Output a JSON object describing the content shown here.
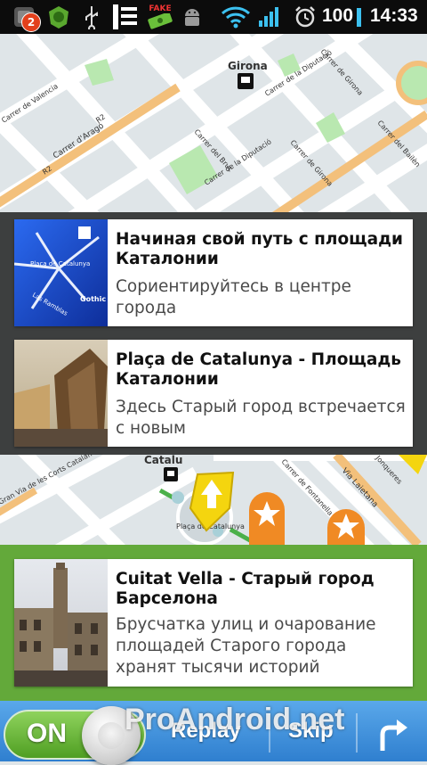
{
  "status_bar": {
    "notification_count": "2",
    "fake_label": "FAKE",
    "battery": "100",
    "time": "14:33",
    "battery_color": "#3cc1f0"
  },
  "map_top": {
    "labels": [
      "Girona",
      "Carrer de Valencia",
      "Carrer d'Aragó",
      "R2",
      "R2",
      "Carrer de la Diputació",
      "Carrer de Girona",
      "Carrer del Bruc",
      "Carrer de la Diputació",
      "Carrer del Bailèn",
      "Carrer de Girona"
    ]
  },
  "cards": [
    {
      "title": "Начиная свой путь с площади Каталонии",
      "description": "Сориентируйтесь в центре города",
      "thumb_labels": [
        "Plaça de Catalunya",
        "Las Ramblas",
        "Gothic quarter"
      ]
    },
    {
      "title": "Plaça de Catalunya - Площадь Каталонии",
      "description": "Здесь Старый город встречается с новым"
    },
    {
      "title": "Cuitat Vella - Старый город Барселона",
      "description": "Брусчатка улиц и очарование площадей Старого города хранят тысячи историй"
    }
  ],
  "map_mid": {
    "labels": [
      "Catalu",
      "Plaça de Catalunya",
      "Via Laietana",
      "Gran Via de les Corts Catalanes",
      "Carrer de Fontanella",
      "Jonqueres"
    ]
  },
  "bottom_bar": {
    "toggle_label": "ON",
    "replay_label": "Replay",
    "skip_label": "Skip",
    "watermark": "ProAndroid.net"
  },
  "colors": {
    "accent_green": "#63a93a",
    "dark_panel": "#3d3f3f",
    "bottom_blue": "#3a8cd9"
  }
}
